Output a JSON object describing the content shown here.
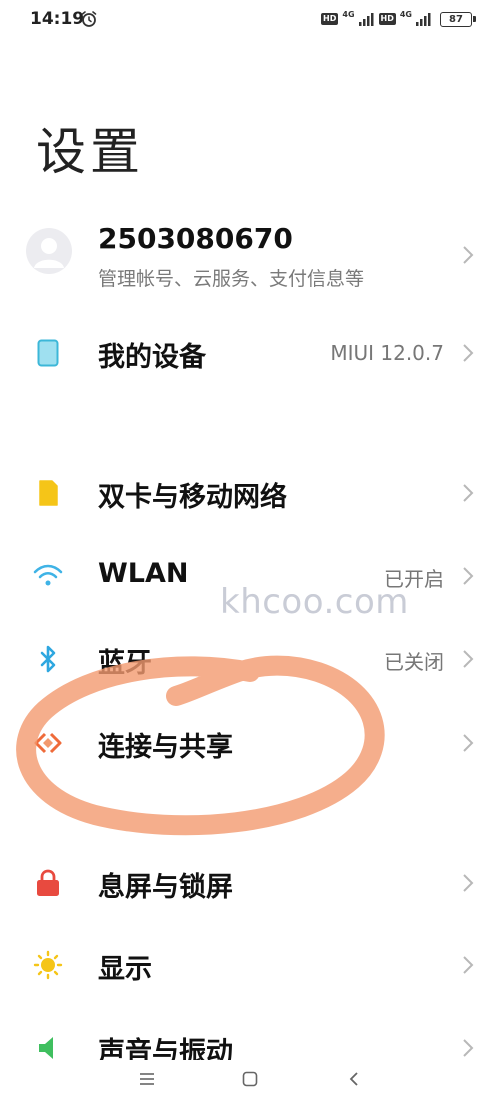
{
  "status_bar": {
    "time": "14:19",
    "hd1": "HD",
    "net1": "4G",
    "hd2": "HD",
    "net2": "4G",
    "battery": "87"
  },
  "title": "设置",
  "account": {
    "id": "2503080670",
    "subtitle": "管理帐号、云服务、支付信息等"
  },
  "device": {
    "label": "我的设备",
    "value": "MIUI 12.0.7"
  },
  "network_items": [
    {
      "label": "双卡与移动网络",
      "value": "",
      "icon": "sim-card-icon",
      "color": "#f5c518"
    },
    {
      "label": "WLAN",
      "value": "已开启",
      "icon": "wifi-icon",
      "color": "#3fb3e6"
    },
    {
      "label": "蓝牙",
      "value": "已关闭",
      "icon": "bluetooth-icon",
      "color": "#2ea7e0"
    },
    {
      "label": "连接与共享",
      "value": "",
      "icon": "share-icon",
      "color": "#ef6b3a"
    }
  ],
  "system_items": [
    {
      "label": "息屏与锁屏",
      "icon": "lock-icon",
      "color": "#e84a3f"
    },
    {
      "label": "显示",
      "icon": "sun-icon",
      "color": "#f5c518"
    },
    {
      "label": "声音与振动",
      "icon": "sound-icon",
      "color": "#3fbf5f"
    }
  ],
  "watermark": "khcoo.com",
  "highlight_color": "#f29a6f",
  "nav": [
    "menu-icon",
    "home-icon",
    "back-icon"
  ]
}
